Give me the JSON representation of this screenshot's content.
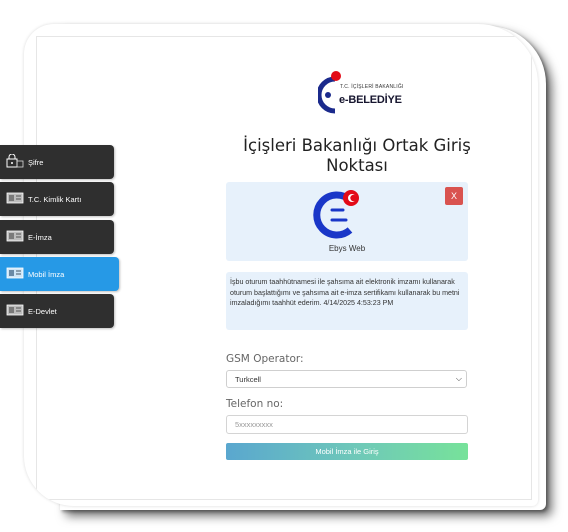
{
  "logo": {
    "small_text": "T.C. İÇİŞLERİ BAKANLIĞI",
    "big_text": "e-BELEDİYE"
  },
  "page": {
    "title": "İçişleri Bakanlığı Ortak Giriş Noktası"
  },
  "app": {
    "name": "Ebys Web",
    "close_label": "X"
  },
  "notice": {
    "text": "İşbu oturum taahhütnamesi ile şahsıma ait elektronik imzamı kullanarak oturum başlattığımı ve şahsıma ait e-imza sertifikamı kullanarak bu metni imzaladığımı taahhüt ederim. 4/14/2025 4:53:23 PM"
  },
  "form": {
    "operator_label": "GSM Operator:",
    "operator_value": "Turkcell",
    "phone_label": "Telefon no:",
    "phone_placeholder": "5xxxxxxxxx",
    "submit_label": "Mobil İmza ile Giriş"
  },
  "tabs": [
    {
      "label": "Şifre",
      "active": false
    },
    {
      "label": "T.C. Kimlik Kartı",
      "active": false
    },
    {
      "label": "E-İmza",
      "active": false
    },
    {
      "label": "Mobil İmza",
      "active": true
    },
    {
      "label": "E-Devlet",
      "active": false
    }
  ],
  "colors": {
    "active_tab": "#2699e6",
    "inactive_tab": "#2f2f2f",
    "close_button": "#d9534f",
    "info_box": "#e7f1fb",
    "brand_blue": "#1a37c8",
    "flag_red": "#e30a17"
  }
}
